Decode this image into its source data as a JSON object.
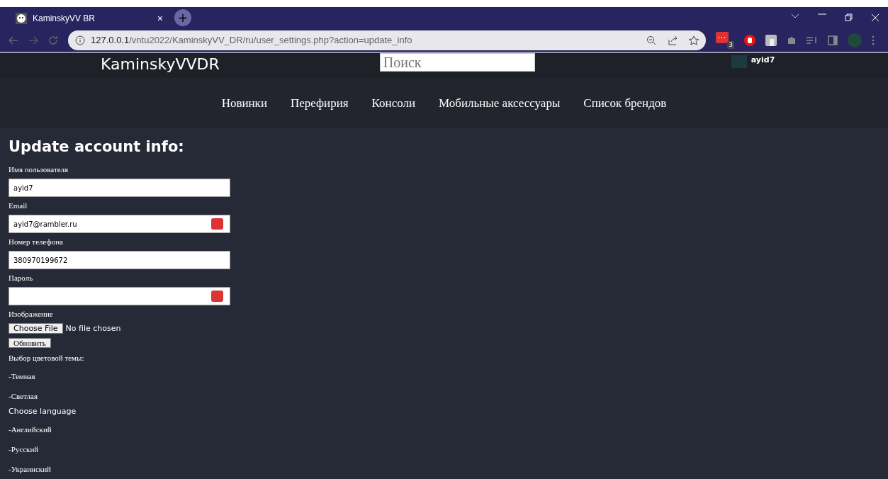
{
  "browser": {
    "tab_title": "KaminskyVV BR",
    "tab_close": "×",
    "new_tab": "+",
    "url_host": "127.0.0.1",
    "url_path": "/vntu2022/KaminskyVV_DR/ru/user_settings.php?action=update_info",
    "extension_badge": "3"
  },
  "header": {
    "logo": "KaminskyVVDR",
    "search": {
      "placeholder": "Поиск"
    },
    "user": "ayid7"
  },
  "nav": [
    "Новинки",
    "Перефирия",
    "Консоли",
    "Мобильные аксессуары",
    "Список брендов"
  ],
  "form": {
    "heading": "Update account info:",
    "fields": [
      {
        "label": "Имя пользователя",
        "value": "ayid7",
        "password_manager": false
      },
      {
        "label": "Email",
        "value": "ayid7@rambler.ru",
        "password_manager": true
      },
      {
        "label": "Номер телефона",
        "value": "380970199672",
        "password_manager": false
      },
      {
        "label": "Пароль",
        "password_manager": true
      }
    ],
    "image_label": "Изображение",
    "file_button": "Choose File",
    "file_status": "No file chosen",
    "submit": "Обновить"
  },
  "theme": {
    "label": "Выбор цветовой темы:",
    "options": [
      "-Темная",
      "-Светлая"
    ]
  },
  "language": {
    "label": "Choose language",
    "options": [
      "-Английский",
      "-Русский",
      "-Украинский"
    ]
  }
}
